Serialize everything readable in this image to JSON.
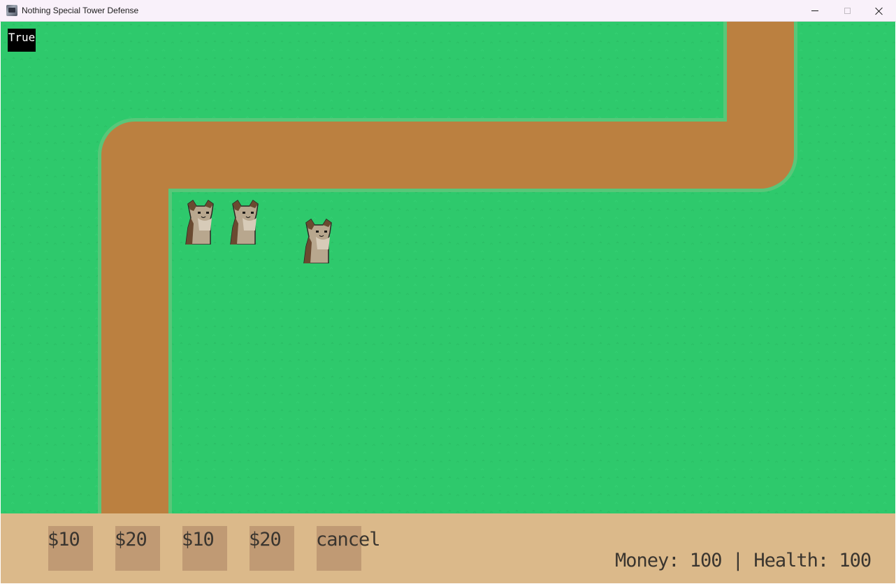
{
  "window": {
    "title": "Nothing Special Tower Defense",
    "icon": "game-app-icon",
    "controls": [
      "minimize",
      "maximize",
      "close"
    ]
  },
  "game": {
    "debug_label": "True",
    "colors": {
      "grass": "#2ec96c",
      "path": "#bb8040",
      "path_edge": "#58c779",
      "panel": "#dbb98a",
      "button": "#c09a74",
      "text": "#3a352f"
    },
    "towers": [
      {
        "type": "cat-tower"
      },
      {
        "type": "cat-tower"
      },
      {
        "type": "cat-tower"
      }
    ]
  },
  "shop": {
    "buttons": [
      {
        "label": "$10"
      },
      {
        "label": "$20"
      },
      {
        "label": "$10"
      },
      {
        "label": "$20"
      },
      {
        "label": "cancel"
      }
    ]
  },
  "status": {
    "text": "Money: 100 | Health: 100"
  }
}
